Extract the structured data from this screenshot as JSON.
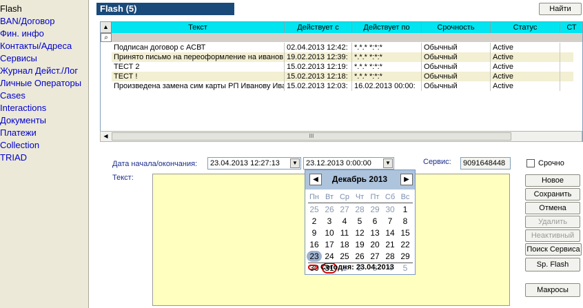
{
  "sidebar": {
    "items": [
      {
        "label": "Flash",
        "active": true
      },
      {
        "label": "BAN/Договор"
      },
      {
        "label": "Фин. инфо"
      },
      {
        "label": "Контакты/Адреса"
      },
      {
        "label": "Сервисы"
      },
      {
        "label": "Журнал Дейст./Лог"
      },
      {
        "label": "Личные Операторы"
      },
      {
        "label": "Cases"
      },
      {
        "label": "Interactions"
      },
      {
        "label": "Документы"
      },
      {
        "label": "Платежи"
      },
      {
        "label": "Collection"
      },
      {
        "label": "TRIAD"
      }
    ]
  },
  "header": {
    "title": "Flash (5)",
    "find_label": "Найти"
  },
  "grid": {
    "columns": [
      "Текст",
      "Действует с",
      "Действует по",
      "Срочность",
      "Статус",
      "СТ"
    ],
    "rows": [
      [
        "Подписан договор с АСВТ",
        "02.04.2013 12:42:",
        "*.*.* *:*:*",
        "Обычный",
        "Active"
      ],
      [
        "Принято письмо на переоформление на иванов",
        "19.02.2013 12:39:",
        "*.*.* *:*:*",
        "Обычный",
        "Active"
      ],
      [
        "ТЕСТ 2",
        "15.02.2013 12:19:",
        "*.*.* *:*:*",
        "Обычный",
        "Active"
      ],
      [
        "ТЕСТ !",
        "15.02.2013 12:18:",
        "*.*.* *:*:*",
        "Обычный",
        "Active"
      ],
      [
        "Произведена замена сим карты РП Иванову Ива",
        "15.02.2013 12:03:",
        "16.02.2013 00:00:",
        "Обычный",
        "Active"
      ]
    ],
    "scroll_grip": "III"
  },
  "form": {
    "date_label": "Дата начала/окончания:",
    "date_start": "23.04.2013 12:27:13",
    "date_end": "23.12.2013  0:00:00",
    "service_label": "Сервис:",
    "service_value": "9091648448",
    "urgent_label": "Срочно",
    "text_label": "Текст:"
  },
  "buttons": {
    "new": "Новое",
    "save": "Сохранить",
    "cancel": "Отмена",
    "delete": "Удалить",
    "inactive": "Неактивный",
    "search_service": "Поиск Сервиса",
    "sp_flash": "Sp. Flash",
    "macros": "Макросы"
  },
  "calendar": {
    "month": "Декабрь 2013",
    "weekdays": [
      "Пн",
      "Вт",
      "Ср",
      "Чт",
      "Пт",
      "Сб",
      "Вс"
    ],
    "weeks": [
      [
        "25",
        "26",
        "27",
        "28",
        "29",
        "30",
        "1"
      ],
      [
        "2",
        "3",
        "4",
        "5",
        "6",
        "7",
        "8"
      ],
      [
        "9",
        "10",
        "11",
        "12",
        "13",
        "14",
        "15"
      ],
      [
        "16",
        "17",
        "18",
        "19",
        "20",
        "21",
        "22"
      ],
      [
        "23",
        "24",
        "25",
        "26",
        "27",
        "28",
        "29"
      ],
      [
        "30",
        "31",
        "1",
        "2",
        "3",
        "4",
        "5"
      ]
    ],
    "today_label": "Сегодня: 23.04.2013"
  },
  "colors": {
    "title_bg": "#1a4a7a",
    "grid_header": "#00e5f0",
    "text_area": "#ffffc0",
    "selected_ring": "#d40000"
  }
}
